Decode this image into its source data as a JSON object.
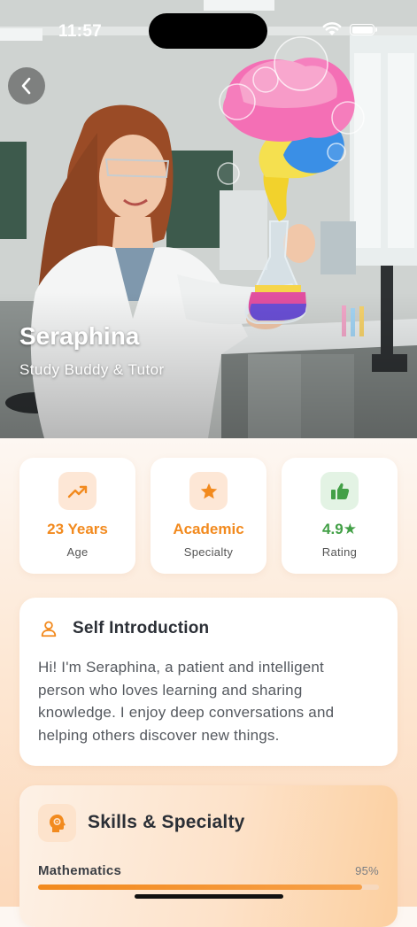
{
  "status_bar": {
    "time": "11:57"
  },
  "profile": {
    "name": "Seraphina",
    "role": "Study Buddy & Tutor"
  },
  "stats": [
    {
      "value": "23 Years",
      "label": "Age",
      "icon": "trend-up-icon",
      "color": "#f28a1e"
    },
    {
      "value": "Academic",
      "label": "Specialty",
      "icon": "star-icon",
      "color": "#f28a1e"
    },
    {
      "value": "4.9",
      "label": "Rating",
      "icon": "thumbs-up-icon",
      "color": "#43a047"
    }
  ],
  "intro": {
    "title": "Self Introduction",
    "icon": "person-icon",
    "text": "Hi! I'm Seraphina, a patient and intelligent person who loves learning and sharing knowledge. I enjoy deep conversations and helping others discover new things."
  },
  "skills": {
    "title": "Skills & Specialty",
    "icon": "brain-gear-icon",
    "items": [
      {
        "name": "Mathematics",
        "percent_label": "95%",
        "percent": 95
      }
    ]
  },
  "colors": {
    "accent": "#f28a1e",
    "rating_green": "#43a047"
  }
}
